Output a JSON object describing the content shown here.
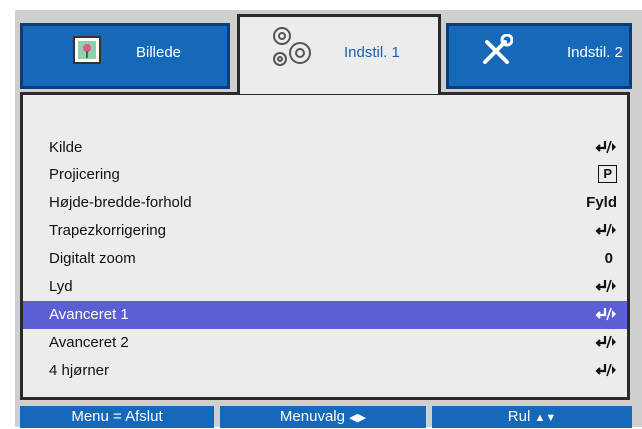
{
  "tabs": [
    {
      "label": "Billede",
      "icon": "picture-icon",
      "active": false
    },
    {
      "label": "Indstil. 1",
      "icon": "gears-icon",
      "active": true
    },
    {
      "label": "Indstil. 2",
      "icon": "tools-icon",
      "active": false
    }
  ],
  "menu": {
    "items": [
      {
        "label": "Kilde",
        "value_icon": "enter-arrow-icon"
      },
      {
        "label": "Projicering",
        "value": "P"
      },
      {
        "label": "Højde-bredde-forhold",
        "value": "Fyld"
      },
      {
        "label": "Trapezkorrigering",
        "value_icon": "enter-arrow-icon"
      },
      {
        "label": "Digitalt zoom",
        "value": "0"
      },
      {
        "label": "Lyd",
        "value_icon": "enter-arrow-icon"
      },
      {
        "label": "Avanceret 1",
        "value_icon": "enter-arrow-icon",
        "selected": true
      },
      {
        "label": "Avanceret 2",
        "value_icon": "enter-arrow-icon"
      },
      {
        "label": "4 hjørner",
        "value_icon": "enter-arrow-icon"
      }
    ]
  },
  "footer": {
    "exit": "Menu = Afslut",
    "select": "Menuvalg",
    "select_icons": "◀▶",
    "scroll": "Rul",
    "scroll_icons": "▲▼"
  },
  "colors": {
    "tab_blue": "#1569b8",
    "selected_row": "#5b5fd3",
    "panel": "#ececec",
    "frame": "#cfcfcf"
  }
}
